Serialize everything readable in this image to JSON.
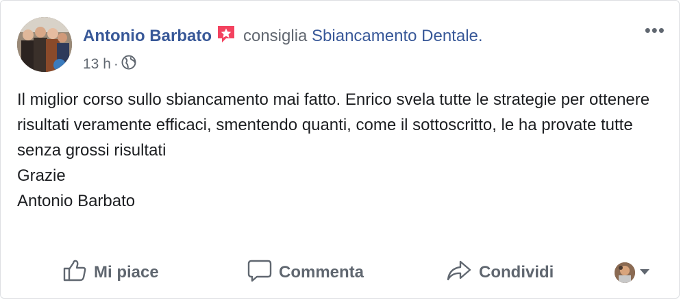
{
  "post": {
    "author": "Antonio Barbato",
    "recommends_text": "consiglia",
    "page_name": "Sbiancamento Dentale",
    "page_suffix": ".",
    "time": "13 h",
    "separator": "·",
    "privacy_icon": "globe-icon",
    "recommend_icon": "recommend-star-icon",
    "more_label": "•••",
    "body_lines": [
      "Il miglior corso sullo sbiancamento mai fatto. Enrico svela tutte le strategie per ottenere risultati veramente efficaci, smentendo quanti, come il sottoscritto, le ha provate tutte senza grossi risultati",
      "Grazie",
      "Antonio Barbato"
    ]
  },
  "actions": {
    "like_label": "Mi piace",
    "comment_label": "Commenta",
    "share_label": "Condividi",
    "like_icon": "thumbs-up-icon",
    "comment_icon": "comment-icon",
    "share_icon": "share-arrow-icon",
    "reactor_icon": "chevron-down-icon"
  },
  "colors": {
    "link": "#385898",
    "secondary_text": "#606770",
    "body_text": "#1c1e21",
    "recommend_badge": "#f3425f"
  }
}
